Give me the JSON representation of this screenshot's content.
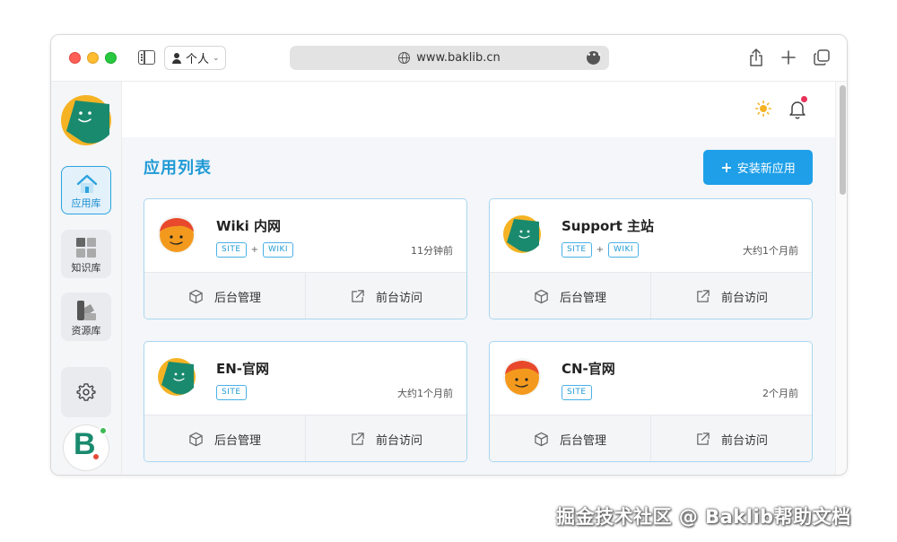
{
  "browser": {
    "profile_label": "个人",
    "url": "www.baklib.cn"
  },
  "sidebar": {
    "items": [
      {
        "label": "应用库",
        "icon": "home-icon",
        "active": true
      },
      {
        "label": "知识库",
        "icon": "grid-icon",
        "active": false
      },
      {
        "label": "资源库",
        "icon": "resources-icon",
        "active": false
      }
    ],
    "settings_icon": "gear-icon",
    "bottom_logo": "B"
  },
  "header": {
    "icons": [
      "sun-icon",
      "bell-icon"
    ]
  },
  "main": {
    "title": "应用列表",
    "install_button": "安装新应用"
  },
  "apps": [
    {
      "name": "Wiki 内网",
      "tags": [
        "SITE",
        "WIKI"
      ],
      "updated": "11分钟前",
      "avatar": "orange"
    },
    {
      "name": "Support 主站",
      "tags": [
        "SITE",
        "WIKI"
      ],
      "updated": "大约1个月前",
      "avatar": "green"
    },
    {
      "name": "EN-官网",
      "tags": [
        "SITE"
      ],
      "updated": "大约1个月前",
      "avatar": "green"
    },
    {
      "name": "CN-官网",
      "tags": [
        "SITE"
      ],
      "updated": "2个月前",
      "avatar": "orange"
    }
  ],
  "card_actions": {
    "admin": "后台管理",
    "visit": "前台访问"
  },
  "colors": {
    "accent": "#1e9fe8",
    "title": "#1f9ad6",
    "avatar_green": "#1a8a6e",
    "avatar_orange": "#f39a1e"
  },
  "watermark": "掘金技术社区 @ Baklib帮助文档"
}
